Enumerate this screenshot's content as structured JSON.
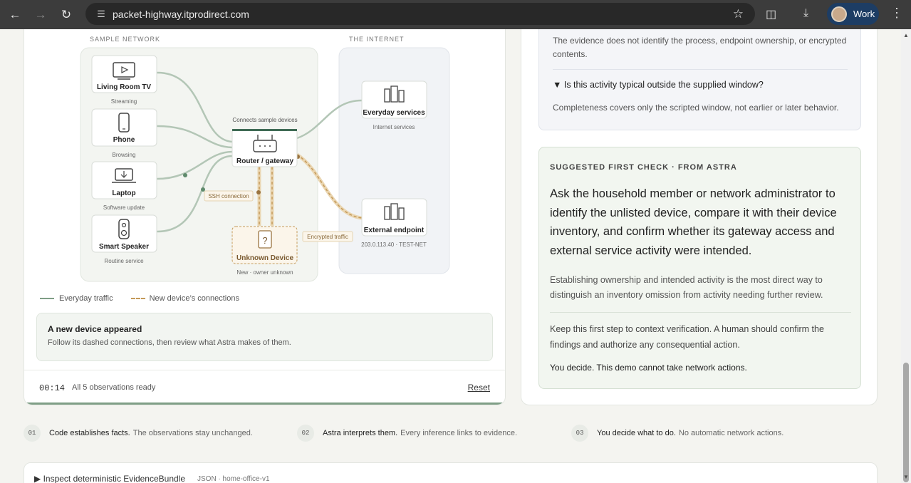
{
  "browser": {
    "url": "packet-highway.itprodirect.com",
    "profile_name": "Work"
  },
  "diagram": {
    "sample_network_label": "SAMPLE NETWORK",
    "internet_label": "THE INTERNET",
    "devices": [
      {
        "name": "Living Room TV",
        "activity": "Streaming"
      },
      {
        "name": "Phone",
        "activity": "Browsing"
      },
      {
        "name": "Laptop",
        "activity": "Software update"
      },
      {
        "name": "Smart Speaker",
        "activity": "Routine service"
      }
    ],
    "router": {
      "caption": "Connects sample devices",
      "name": "Router / gateway"
    },
    "unknown_device": {
      "name": "Unknown Device",
      "caption": "New · owner unknown"
    },
    "everyday_services": {
      "name": "Everyday services",
      "caption": "Internet services"
    },
    "external_endpoint": {
      "name": "External endpoint",
      "caption": "203.0.113.40 · TEST-NET"
    },
    "ssh_label": "SSH connection",
    "encrypted_label": "Encrypted traffic"
  },
  "legend": {
    "everyday": "Everyday traffic",
    "new_device": "New device’s connections"
  },
  "callout": {
    "title": "A new device appeared",
    "desc": "Follow its dashed connections, then review what Astra makes of them."
  },
  "footer": {
    "time": "00:14",
    "status": "All 5 observations ready",
    "reset": "Reset"
  },
  "faq": {
    "answer_1": "The evidence does not identify the process, endpoint ownership, or encrypted contents.",
    "question_2": "▼ Is this activity typical outside the supplied window?",
    "answer_2": "Completeness covers only the scripted window, not earlier or later behavior."
  },
  "suggestion": {
    "eyebrow": "SUGGESTED FIRST CHECK · FROM ASTRA",
    "headline": "Ask the household member or network administrator to identify the unlisted device, compare it with their device inventory, and confirm whether its gateway access and external service activity were intended.",
    "body1": "Establishing ownership and intended activity is the most direct way to distinguish an inventory omission from activity needing further review.",
    "body2": "Keep this first step to context verification. A human should confirm the findings and authorize any consequential action.",
    "final": "You decide. This demo cannot take network actions."
  },
  "steps": [
    {
      "num": "01",
      "strong": "Code establishes facts.",
      "rest": "The observations stay unchanged."
    },
    {
      "num": "02",
      "strong": "Astra interprets them.",
      "rest": "Every inference links to evidence."
    },
    {
      "num": "03",
      "strong": "You decide what to do.",
      "rest": "No automatic network actions."
    }
  ],
  "bundle": {
    "label": "▶ Inspect deterministic EvidenceBundle",
    "meta": "JSON · home-office-v1"
  },
  "colors": {
    "everyday_line": "#a9bfae",
    "new_device_line": "#c49a5a",
    "accent_green": "#3f6b55"
  }
}
